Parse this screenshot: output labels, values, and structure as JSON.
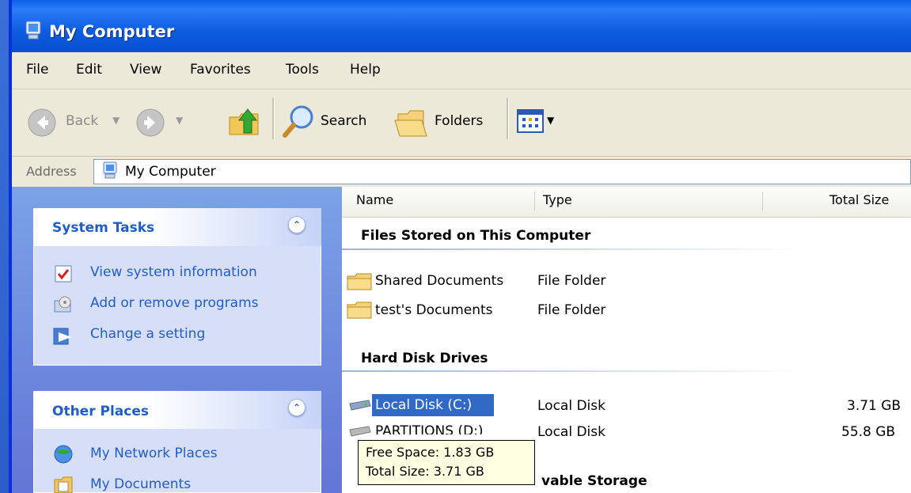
{
  "window": {
    "title": "My Computer"
  },
  "menu": [
    "File",
    "Edit",
    "View",
    "Favorites",
    "Tools",
    "Help"
  ],
  "toolbar": {
    "back": "Back",
    "search": "Search",
    "folders": "Folders"
  },
  "address": {
    "label": "Address",
    "value": "My Computer"
  },
  "left_pane": {
    "system_tasks": {
      "title": "System Tasks",
      "items": [
        "View system information",
        "Add or remove programs",
        "Change a setting"
      ]
    },
    "other_places": {
      "title": "Other Places",
      "items": [
        "My Network Places",
        "My Documents"
      ]
    }
  },
  "columns": [
    "Name",
    "Type",
    "Total Size"
  ],
  "groups": {
    "files_stored": {
      "title": "Files Stored on This Computer",
      "rows": [
        {
          "name": "Shared Documents",
          "type": "File Folder"
        },
        {
          "name": "test's Documents",
          "type": "File Folder"
        }
      ]
    },
    "hard_disks": {
      "title": "Hard Disk Drives",
      "rows": [
        {
          "name": "Local Disk (C:)",
          "type": "Local Disk",
          "size": "3.71 GB"
        },
        {
          "name": "PARTITIONS (D:)",
          "type": "Local Disk",
          "size": "55.8 GB"
        }
      ]
    },
    "removable": {
      "title_visible_fragment": "vable Storage"
    }
  },
  "tooltip": {
    "line1": "Free Space: 1.83 GB",
    "line2": "Total Size: 3.71 GB"
  },
  "colors": {
    "title_bar": "#0a5ee6",
    "task_link": "#215dc6",
    "selection": "#316ac5",
    "tooltip_bg": "#ffffe1"
  }
}
